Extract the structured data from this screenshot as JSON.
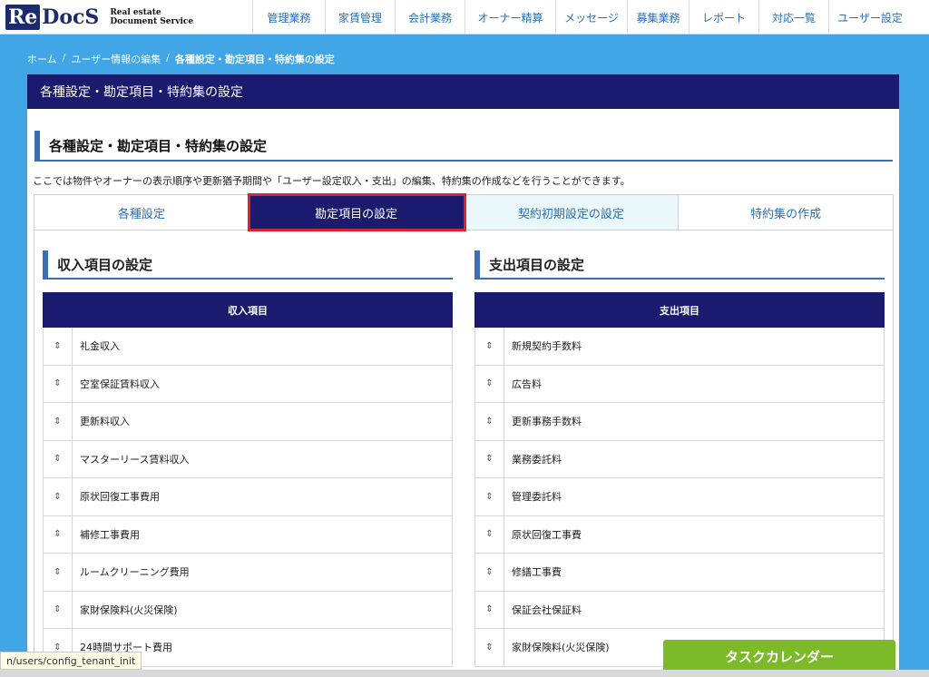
{
  "logo": {
    "re": "Re",
    "docs": "DocS",
    "sub1": "Real estate",
    "sub2": "Document Service"
  },
  "nav": [
    {
      "label": "管理業務",
      "w": 80
    },
    {
      "label": "家賃管理",
      "w": 77
    },
    {
      "label": "会計業務",
      "w": 77
    },
    {
      "label": "オーナー精算",
      "w": 100
    },
    {
      "label": "メッセージ",
      "w": 79
    },
    {
      "label": "募集業務",
      "w": 68
    },
    {
      "label": "レポート",
      "w": 77
    },
    {
      "label": "対応一覧",
      "w": 77
    },
    {
      "label": "ユーザー設定",
      "w": 91
    }
  ],
  "breadcrumb": {
    "home": "ホーム",
    "sep": "/",
    "user": "ユーザー情報の編集",
    "current": "各種設定・勘定項目・特約集の設定"
  },
  "panel": {
    "header": "各種設定・勘定項目・特約集の設定",
    "section_title": "各種設定・勘定項目・特約集の設定",
    "description": "ここでは物件やオーナーの表示順序や更新猶予期間や「ユーザー設定収入・支出」の編集、特約集の作成などを行うことができます。"
  },
  "tabs": [
    {
      "label": "各種設定"
    },
    {
      "label": "勘定項目の設定"
    },
    {
      "label": "契約初期設定の設定"
    },
    {
      "label": "特約集の作成"
    }
  ],
  "income": {
    "title": "収入項目の設定",
    "table_header": "収入項目",
    "items": [
      "礼金収入",
      "空室保証賃料収入",
      "更新料収入",
      "マスターリース賃料収入",
      "原状回復工事費用",
      "補修工事費用",
      "ルームクリーニング費用",
      "家財保険料(火災保険)",
      "24時間サポート費用"
    ]
  },
  "expense": {
    "title": "支出項目の設定",
    "table_header": "支出項目",
    "items": [
      "新規契約手数料",
      "広告料",
      "更新事務手数料",
      "業務委託料",
      "管理委託料",
      "原状回復工事費",
      "修繕工事費",
      "保証会社保証料",
      "家財保険料(火災保険)"
    ]
  },
  "handle_glyph": "⇕",
  "task_button": "タスクカレンダー",
  "status_url": "n/users/config_tenant_init"
}
